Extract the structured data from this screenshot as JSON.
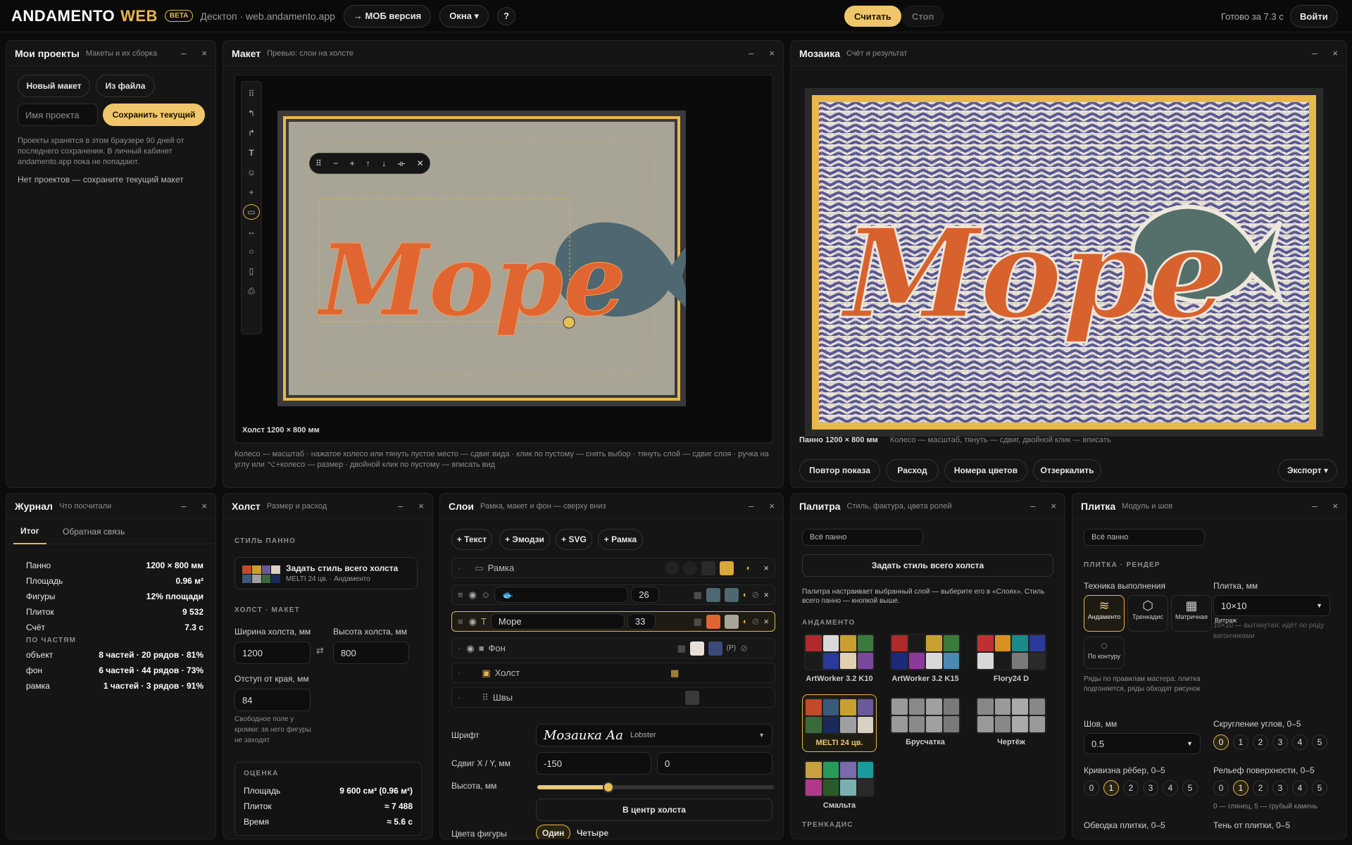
{
  "topbar": {
    "logo": "ANDAMENTO",
    "logo_web": "WEB",
    "beta": "BETA",
    "subtitle": "Десктоп · web.andamento.app",
    "mob": "→ МОБ версия",
    "windows": "Окна ▾",
    "help": "?",
    "calc": "Считать",
    "stop": "Стоп",
    "status": "Готово за 7.3 с",
    "login": "Войти"
  },
  "projects": {
    "title": "Мои проекты",
    "subtitle": "Макеты и их сборка",
    "new": "Новый макет",
    "from_file": "Из файла",
    "name_placeholder": "Имя проекта",
    "save": "Сохранить текущий",
    "note": "Проекты хранятся в этом браузере 90 дней от последнего сохранения. В личный кабинет andamento.app пока не попадают.",
    "empty": "Нет проектов — сохраните текущий макет"
  },
  "layout": {
    "title": "Макет",
    "subtitle": "Превью: слои на холсте",
    "canvas_label": "Холст 1200 × 800 мм",
    "word": "Море",
    "hint": "Колесо — масштаб · нажатое колесо или тянуть пустое место — сдвиг вида · клик по пустому — снять выбор · тянуть слой — сдвиг слоя · ручка на углу или ⌥+колесо — размер · двойной клик по пустому — вписать вид",
    "float_tools": [
      "⠿",
      "−",
      "+",
      "↑",
      "↓",
      "⟛",
      "✕"
    ]
  },
  "mosaic": {
    "title": "Мозаика",
    "subtitle": "Счёт и результат",
    "word": "Море",
    "panel_label": "Панно 1200 × 800 мм",
    "hint": "Колесо — масштаб, тянуть — сдвиг, двойной клик — вписать",
    "replay": "Повтор показа",
    "usage": "Расход",
    "color_numbers": "Номера цветов",
    "mirror": "Отзеркалить",
    "export": "Экспорт ▾"
  },
  "journal": {
    "title": "Журнал",
    "subtitle": "Что посчитали",
    "tab_total": "Итог",
    "tab_feedback": "Обратная связь",
    "rows": [
      {
        "k": "Панно",
        "v": "1200 × 800 мм"
      },
      {
        "k": "Площадь",
        "v": "0.96 м²"
      },
      {
        "k": "Фигуры",
        "v": "12% площади"
      },
      {
        "k": "Плиток",
        "v": "9 532"
      },
      {
        "k": "Счёт",
        "v": "7.3 с"
      }
    ],
    "parts_title": "ПО ЧАСТЯМ",
    "parts": [
      {
        "k": "объект",
        "v": "8 частей · 20 рядов · 81%"
      },
      {
        "k": "фон",
        "v": "6 частей · 44 рядов · 73%"
      },
      {
        "k": "рамка",
        "v": "1 частей · 3 рядов · 91%"
      }
    ]
  },
  "canvas": {
    "title": "Холст",
    "subtitle": "Размер и расход",
    "style_sec": "СТИЛЬ ПАННО",
    "style_btn": "Задать стиль всего холста",
    "style_sub": "MELTI 24 цв. · Андаменто",
    "layout_sec": "ХОЛСТ · МАКЕТ",
    "width_lbl": "Ширина холста, мм",
    "width": "1200",
    "height_lbl": "Высота холста, мм",
    "height": "800",
    "margin_lbl": "Отступ от края, мм",
    "margin": "84",
    "margin_note": "Свободное поле у кромки: за него фигуры не заходят",
    "est_sec": "ОЦЕНКА",
    "est": [
      {
        "k": "Площадь",
        "v": "9 600 см² (0.96 м²)"
      },
      {
        "k": "Плиток",
        "v": "≈ 7 488"
      },
      {
        "k": "Время",
        "v": "≈ 5.6 с"
      }
    ]
  },
  "layers": {
    "title": "Слои",
    "subtitle": "Рамка, макет и фон — сверху вниз",
    "add_text": "+ Текст",
    "add_emoji": "+ Эмодзи",
    "add_svg": "+ SVG",
    "add_frame": "+ Рамка",
    "items": [
      {
        "name": "Рамка",
        "num": ""
      },
      {
        "name": "🐟",
        "num": "26"
      },
      {
        "name": "Море",
        "num": "33"
      },
      {
        "name": "Фон",
        "num": ""
      },
      {
        "name": "Холст",
        "num": ""
      },
      {
        "name": "Швы",
        "num": ""
      }
    ],
    "font_lbl": "Шрифт",
    "font_preview": "Мозаика Аа",
    "font_name": "Lobster",
    "shift_lbl": "Сдвиг X / Y, мм",
    "shift_x": "-150",
    "shift_y": "0",
    "height_lbl": "Высота, мм",
    "height_value": 0.3,
    "center": "В центр холста",
    "colors_lbl": "Цвета фигуры",
    "one": "Один",
    "four": "Четыре"
  },
  "palette": {
    "title": "Палитра",
    "subtitle": "Стиль, фактура, цвета ролей",
    "scope": "Всё панно",
    "set_style": "Задать стиль всего холста",
    "note": "Палитра настраивает выбранный слой — выберите его в «Слоях». Стиль всего панно — кнопкой выше.",
    "sec": "АНДАМЕНТО",
    "sec2": "ТРЕНКАДИС",
    "items": [
      {
        "name": "ArtWorker 3.2 K10",
        "colors": [
          "#b02a2a",
          "#d8d8d8",
          "#c9a030",
          "#3a7a3a",
          "#1a1a1a",
          "#2a3a9a",
          "#e0d0b0",
          "#7a4a9a"
        ]
      },
      {
        "name": "ArtWorker 3.2 K15",
        "colors": [
          "#b02a2a",
          "#1a1a1a",
          "#c9a030",
          "#3a7a3a",
          "#1c2a7a",
          "#8a3a9a",
          "#d8d8d8",
          "#4a8ab0"
        ]
      },
      {
        "name": "Flory24 D",
        "colors": [
          "#c03030",
          "#d89020",
          "#1a8a8a",
          "#2a3a9a",
          "#d8d8d8",
          "#1a1a1a",
          "#7a7a7a",
          "#2a2a2a"
        ]
      },
      {
        "name": "MELTI 24 цв.",
        "colors": [
          "#c04a2a",
          "#3a5a7a",
          "#c9a030",
          "#6a5a9a",
          "#3a6a3a",
          "#1a2a5a",
          "#a0a0a0",
          "#d8d0c0"
        ]
      },
      {
        "name": "Брусчатка",
        "colors": [
          "#9a9a9a",
          "#8a8a8a",
          "#a0a0a0",
          "#7a7a7a",
          "#9a9a9a",
          "#8a8a8a",
          "#a0a0a0",
          "#7a7a7a"
        ]
      },
      {
        "name": "Чертёж",
        "colors": [
          "#888",
          "#999",
          "#aaa",
          "#888",
          "#999",
          "#888",
          "#aaa",
          "#999"
        ]
      },
      {
        "name": "Смальта",
        "colors": [
          "#c9a040",
          "#2a9a5a",
          "#7a6ab0",
          "#1a9a9a",
          "#b03a8a",
          "#2a5a2a",
          "#7ab0b0",
          "#2a2a2a"
        ]
      }
    ]
  },
  "tile": {
    "title": "Плитка",
    "subtitle": "Модуль и шов",
    "scope": "Всё панно",
    "sec": "ПЛИТКА · РЕНДЕР",
    "technique_lbl": "Техника выполнения",
    "tech": [
      {
        "name": "Андаменто"
      },
      {
        "name": "Тренкадис"
      },
      {
        "name": "Матричная"
      },
      {
        "name": "Витраж"
      },
      {
        "name": "По контуру"
      }
    ],
    "tile_lbl": "Плитка, мм",
    "tile_value": "10×10",
    "tile_note": "10×10 — вытянутая: идёт по ряду вагончиками",
    "rows_note": "Ряды по правилам мастера: плитка подгоняется, ряды обходят рисунок",
    "seam_lbl": "Шов, мм",
    "seam": "0.5",
    "round_lbl": "Скругление углов, 0–5",
    "curve_lbl": "Кривизна рёбер, 0–5",
    "relief_lbl": "Рельеф поверхности, 0–5",
    "relief_note": "0 — глянец, 5 — грубый камень",
    "stroke_lbl": "Обводка плитки, 0–5",
    "shadow_lbl": "Тень от плитки, 0–5",
    "scale": [
      "0",
      "1",
      "2",
      "3",
      "4",
      "5"
    ],
    "round_val": 0,
    "curve_val": 1,
    "relief_val": 1
  }
}
